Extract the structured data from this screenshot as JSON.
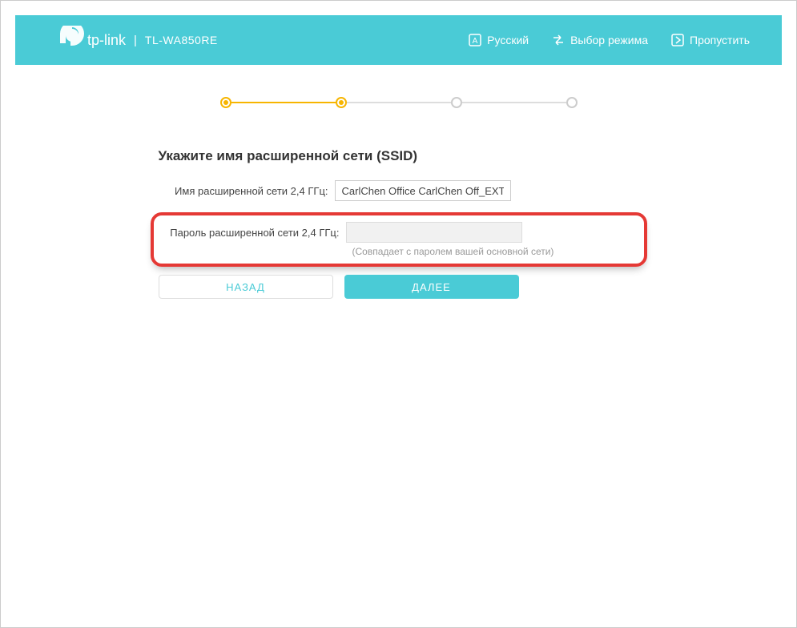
{
  "header": {
    "brand": "tp-link",
    "model": "TL-WA850RE",
    "language": "Русский",
    "mode": "Выбор режима",
    "skip": "Пропустить"
  },
  "wizard": {
    "current_step": 2,
    "total_steps": 4
  },
  "form": {
    "title": "Укажите имя расширенной сети (SSID)",
    "ssid_label": "Имя расширенной сети 2,4 ГГц:",
    "ssid_value": "CarlChen Office CarlChen Off_EXT",
    "password_label": "Пароль расширенной сети 2,4 ГГц:",
    "password_value": "",
    "password_hint": "(Совпадает с паролем вашей основной сети)"
  },
  "buttons": {
    "back": "НАЗАД",
    "next": "ДАЛЕЕ"
  },
  "colors": {
    "primary": "#4acbd6",
    "accent": "#f7b500",
    "highlight": "#e53935"
  }
}
